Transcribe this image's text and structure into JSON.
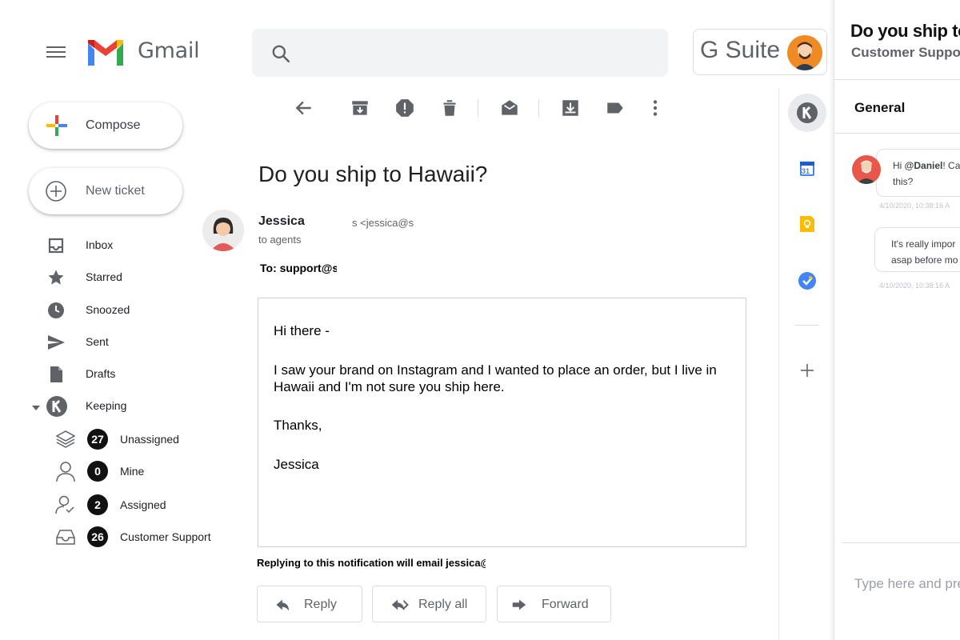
{
  "app": {
    "name": "Gmail",
    "suite": "G Suite"
  },
  "sidebar": {
    "compose_label": "Compose",
    "new_ticket_label": "New ticket",
    "items": [
      {
        "label": "Inbox",
        "icon": "inbox-icon"
      },
      {
        "label": "Starred",
        "icon": "star-icon"
      },
      {
        "label": "Snoozed",
        "icon": "clock-icon"
      },
      {
        "label": "Sent",
        "icon": "send-icon"
      },
      {
        "label": "Drafts",
        "icon": "draft-icon"
      },
      {
        "label": "Keeping",
        "icon": "keeping-logo-icon"
      }
    ],
    "keeping_items": [
      {
        "label": "Unassigned",
        "count": "27",
        "icon": "layers-icon"
      },
      {
        "label": "Mine",
        "count": "0",
        "icon": "person-icon"
      },
      {
        "label": "Assigned",
        "count": "2",
        "icon": "person-check-icon"
      },
      {
        "label": "Customer Support",
        "count": "26",
        "icon": "tray-icon"
      }
    ]
  },
  "toolbar": {
    "icons": [
      "back-arrow-icon",
      "archive-icon",
      "report-spam-icon",
      "delete-icon",
      "mark-unread-icon",
      "move-to-icon",
      "label-icon",
      "more-vert-icon"
    ]
  },
  "email": {
    "subject": "Do you ship to Hawaii?",
    "sender_name": "Jessica",
    "sender_email": "s <jessica@s",
    "to_agents": "to agents",
    "to_line": "To: support@s",
    "body": {
      "greeting": "Hi there -",
      "line1": "I saw your brand on Instagram and I wanted to place an order, but I live in",
      "line2": "Hawaii and I'm not sure you ship here.",
      "closing": "Thanks,",
      "signature": "Jessica"
    },
    "reply_note": "Replying to this notification will email jessica@s",
    "actions": {
      "reply": "Reply",
      "reply_all": "Reply all",
      "forward": "Forward"
    }
  },
  "rail": {
    "icons": [
      "keeping-icon",
      "calendar-icon",
      "keep-notes-icon",
      "tasks-icon",
      "add-icon"
    ],
    "calendar_day": "31"
  },
  "side_panel": {
    "title": "Do you ship to H",
    "subtitle": "Customer Suppo",
    "tab": "General",
    "messages": [
      {
        "text_prefix": "Hi ",
        "mention": "@Daniel",
        "text_suffix": "! Ca",
        "line2": "this?",
        "time": "4/10/2020, 10:38:16 A"
      },
      {
        "line1": "It's really impor",
        "line2": "asap before mo",
        "time": "4/10/2020, 10:38:16 A"
      }
    ],
    "input_placeholder": "Type here and pre"
  },
  "colors": {
    "accent_blue": "#1a73e8",
    "gmail_red": "#ea4335",
    "badge_black": "#111111",
    "avatar_orange": "#f08a24"
  }
}
